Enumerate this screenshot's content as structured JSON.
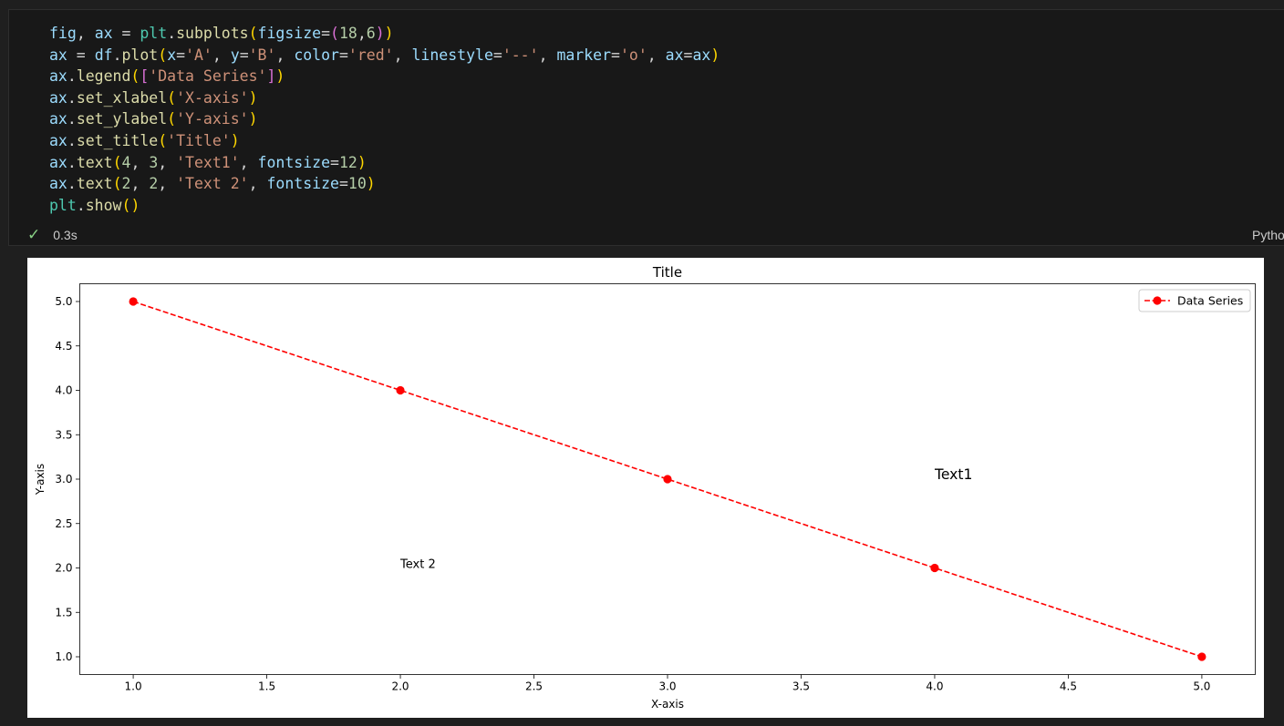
{
  "code_cell": {
    "lines": [
      [
        [
          "var",
          "fig"
        ],
        [
          "op",
          ", "
        ],
        [
          "var",
          "ax"
        ],
        [
          "op",
          " = "
        ],
        [
          "cls",
          "plt"
        ],
        [
          "op",
          "."
        ],
        [
          "fn",
          "subplots"
        ],
        [
          "p1",
          "("
        ],
        [
          "var",
          "figsize"
        ],
        [
          "op",
          "="
        ],
        [
          "p2",
          "("
        ],
        [
          "num",
          "18"
        ],
        [
          "op",
          ","
        ],
        [
          "num",
          "6"
        ],
        [
          "p2",
          ")"
        ],
        [
          "p1",
          ")"
        ]
      ],
      [
        [
          "var",
          "ax"
        ],
        [
          "op",
          " = "
        ],
        [
          "var",
          "df"
        ],
        [
          "op",
          "."
        ],
        [
          "fn",
          "plot"
        ],
        [
          "p1",
          "("
        ],
        [
          "var",
          "x"
        ],
        [
          "op",
          "="
        ],
        [
          "str",
          "'A'"
        ],
        [
          "op",
          ", "
        ],
        [
          "var",
          "y"
        ],
        [
          "op",
          "="
        ],
        [
          "str",
          "'B'"
        ],
        [
          "op",
          ", "
        ],
        [
          "var",
          "color"
        ],
        [
          "op",
          "="
        ],
        [
          "str",
          "'red'"
        ],
        [
          "op",
          ", "
        ],
        [
          "var",
          "linestyle"
        ],
        [
          "op",
          "="
        ],
        [
          "str",
          "'--'"
        ],
        [
          "op",
          ", "
        ],
        [
          "var",
          "marker"
        ],
        [
          "op",
          "="
        ],
        [
          "str",
          "'o'"
        ],
        [
          "op",
          ", "
        ],
        [
          "var",
          "ax"
        ],
        [
          "op",
          "="
        ],
        [
          "var",
          "ax"
        ],
        [
          "p1",
          ")"
        ]
      ],
      [
        [
          "var",
          "ax"
        ],
        [
          "op",
          "."
        ],
        [
          "fn",
          "legend"
        ],
        [
          "p1",
          "("
        ],
        [
          "p2",
          "["
        ],
        [
          "str",
          "'Data Series'"
        ],
        [
          "p2",
          "]"
        ],
        [
          "p1",
          ")"
        ]
      ],
      [
        [
          "var",
          "ax"
        ],
        [
          "op",
          "."
        ],
        [
          "fn",
          "set_xlabel"
        ],
        [
          "p1",
          "("
        ],
        [
          "str",
          "'X-axis'"
        ],
        [
          "p1",
          ")"
        ]
      ],
      [
        [
          "var",
          "ax"
        ],
        [
          "op",
          "."
        ],
        [
          "fn",
          "set_ylabel"
        ],
        [
          "p1",
          "("
        ],
        [
          "str",
          "'Y-axis'"
        ],
        [
          "p1",
          ")"
        ]
      ],
      [
        [
          "var",
          "ax"
        ],
        [
          "op",
          "."
        ],
        [
          "fn",
          "set_title"
        ],
        [
          "p1",
          "("
        ],
        [
          "str",
          "'Title'"
        ],
        [
          "p1",
          ")"
        ]
      ],
      [
        [
          "var",
          "ax"
        ],
        [
          "op",
          "."
        ],
        [
          "fn",
          "text"
        ],
        [
          "p1",
          "("
        ],
        [
          "num",
          "4"
        ],
        [
          "op",
          ", "
        ],
        [
          "num",
          "3"
        ],
        [
          "op",
          ", "
        ],
        [
          "str",
          "'Text1'"
        ],
        [
          "op",
          ", "
        ],
        [
          "var",
          "fontsize"
        ],
        [
          "op",
          "="
        ],
        [
          "num",
          "12"
        ],
        [
          "p1",
          ")"
        ]
      ],
      [
        [
          "var",
          "ax"
        ],
        [
          "op",
          "."
        ],
        [
          "fn",
          "text"
        ],
        [
          "p1",
          "("
        ],
        [
          "num",
          "2"
        ],
        [
          "op",
          ", "
        ],
        [
          "num",
          "2"
        ],
        [
          "op",
          ", "
        ],
        [
          "str",
          "'Text 2'"
        ],
        [
          "op",
          ", "
        ],
        [
          "var",
          "fontsize"
        ],
        [
          "op",
          "="
        ],
        [
          "num",
          "10"
        ],
        [
          "p1",
          ")"
        ]
      ],
      [
        [
          "cls",
          "plt"
        ],
        [
          "op",
          "."
        ],
        [
          "fn",
          "show"
        ],
        [
          "p1",
          "("
        ],
        [
          "p1",
          ")"
        ]
      ]
    ],
    "status_icon": "check-icon",
    "exec_time": "0.3s",
    "kernel_label": "Python"
  },
  "colors": {
    "series": "#ff0000",
    "success": "#89d185"
  },
  "chart_data": {
    "type": "line",
    "title": "Title",
    "xlabel": "X-axis",
    "ylabel": "Y-axis",
    "x": [
      1,
      2,
      3,
      4,
      5
    ],
    "series": [
      {
        "name": "Data Series",
        "values": [
          5,
          4,
          3,
          2,
          1
        ],
        "color": "#ff0000",
        "linestyle": "dashed",
        "marker": "circle"
      }
    ],
    "xlim": [
      0.8,
      5.2
    ],
    "ylim": [
      0.8,
      5.2
    ],
    "xticks": [
      "1.0",
      "1.5",
      "2.0",
      "2.5",
      "3.0",
      "3.5",
      "4.0",
      "4.5",
      "5.0"
    ],
    "yticks": [
      "1.0",
      "1.5",
      "2.0",
      "2.5",
      "3.0",
      "3.5",
      "4.0",
      "4.5",
      "5.0"
    ],
    "annotations": [
      {
        "text": "Text1",
        "x": 4,
        "y": 3,
        "fontsize": 12
      },
      {
        "text": "Text 2",
        "x": 2,
        "y": 2,
        "fontsize": 10
      }
    ],
    "legend": {
      "position": "top-right",
      "labels": [
        "Data Series"
      ]
    },
    "grid": false
  }
}
